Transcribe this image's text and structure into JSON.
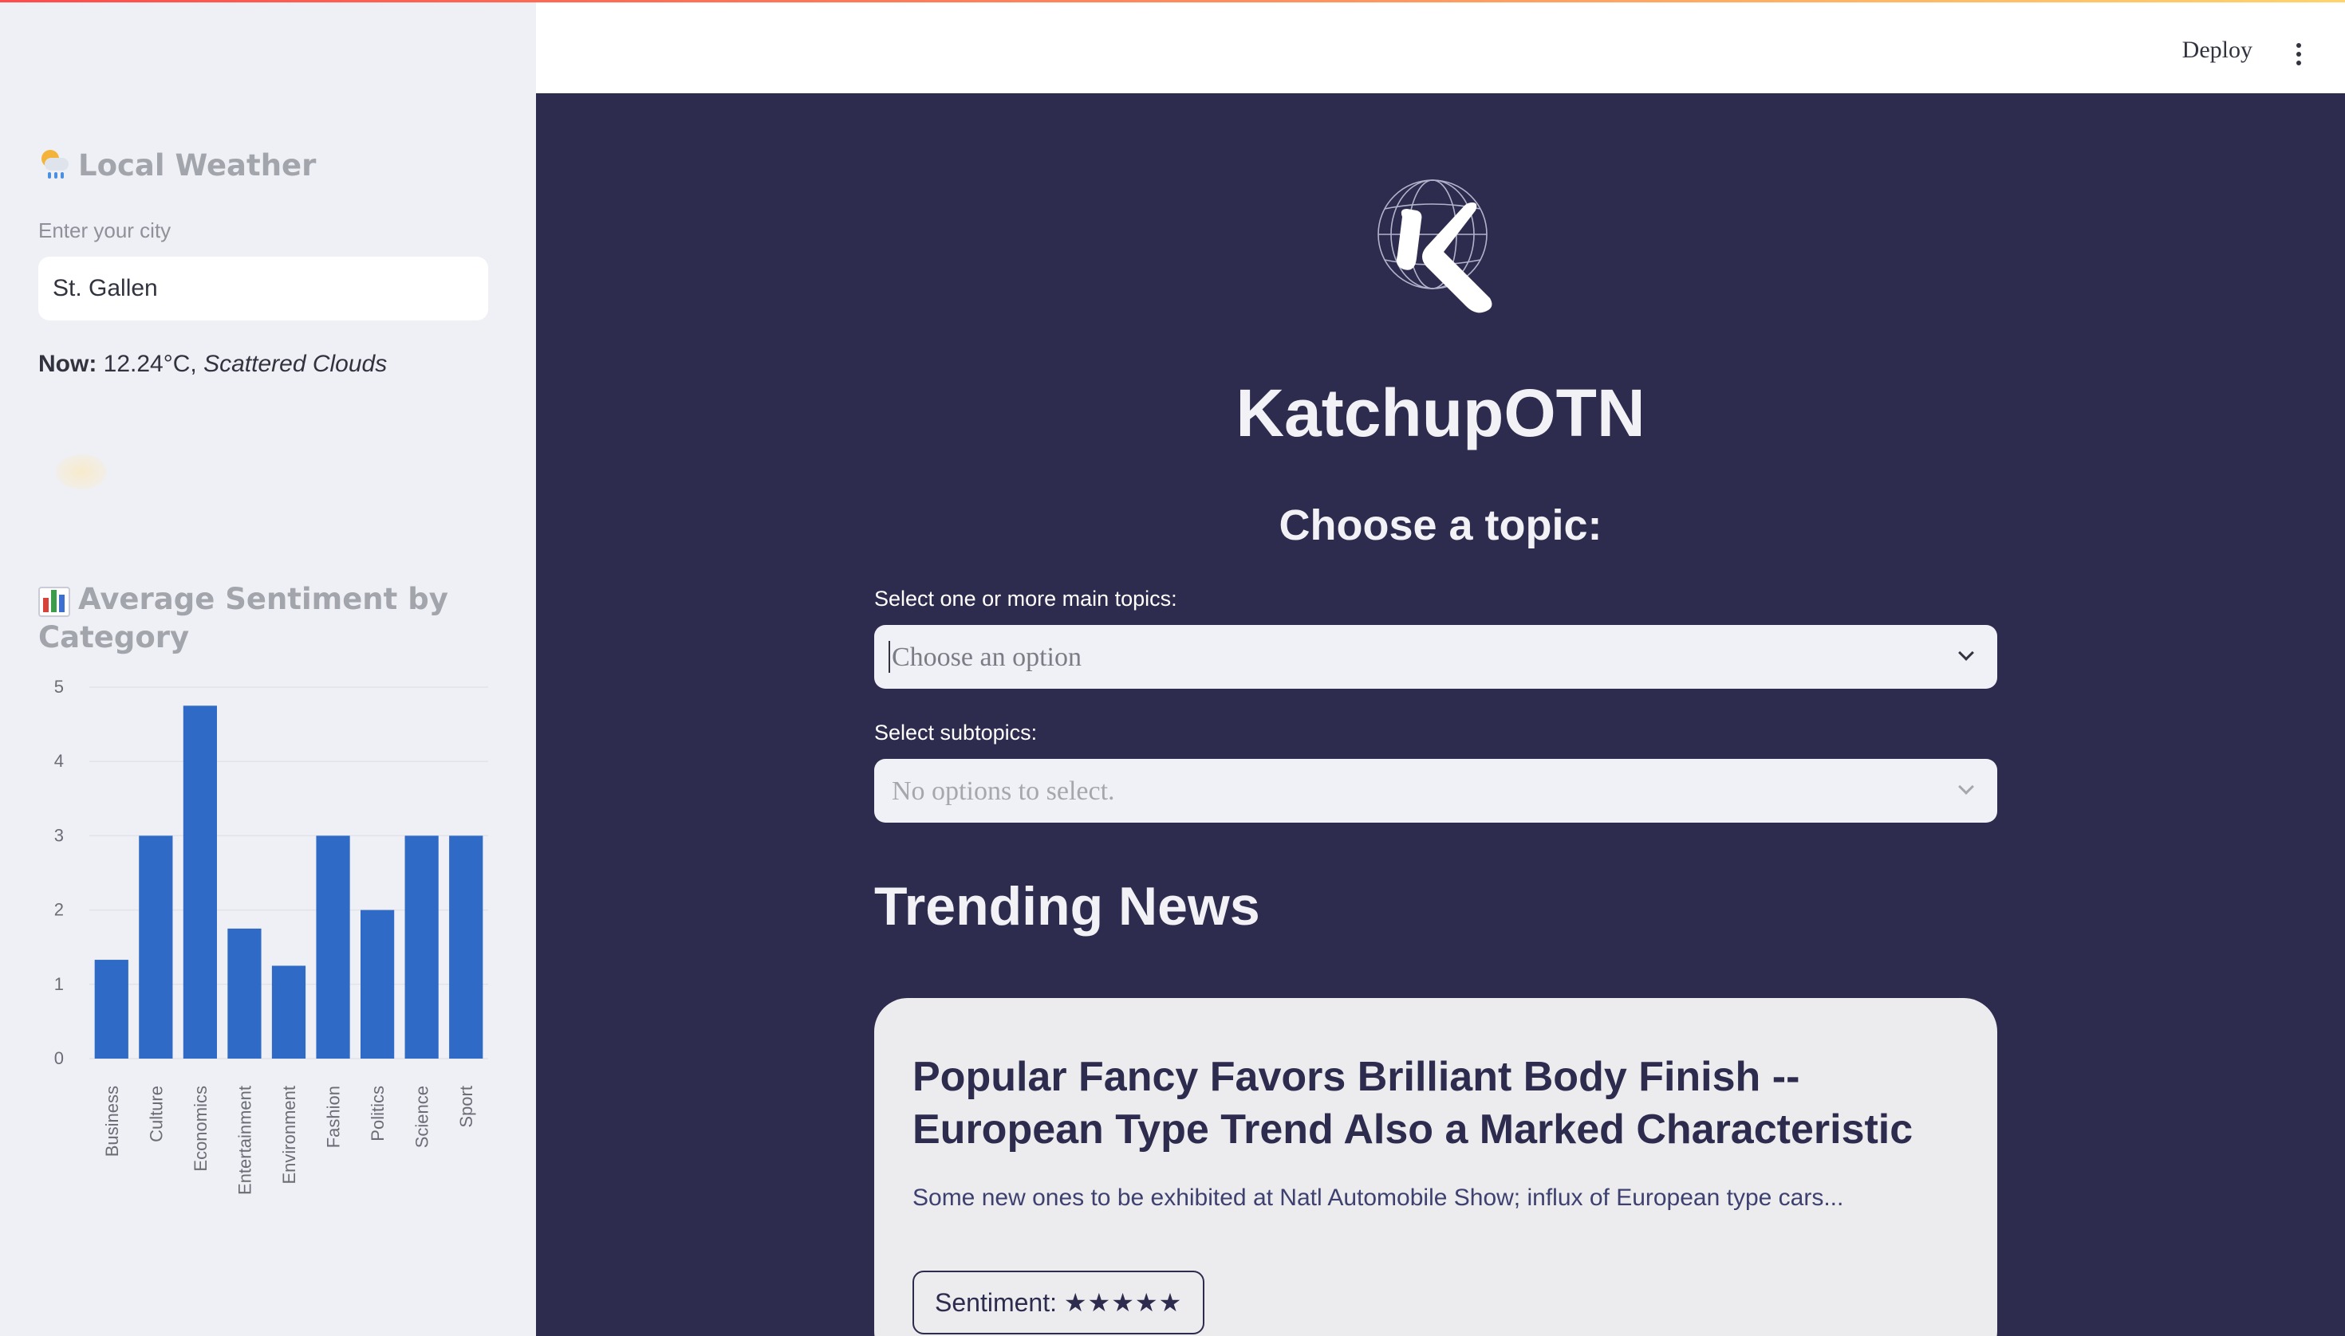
{
  "header": {
    "deploy_label": "Deploy"
  },
  "sidebar": {
    "weather": {
      "icon": "sun-cloud-rain-icon",
      "title": "Local Weather",
      "city_label": "Enter your city",
      "city_value": "St. Gallen",
      "now_label": "Now:",
      "now_temp": "12.24°C,",
      "now_condition": "Scattered Clouds"
    },
    "sentiment": {
      "icon": "bar-chart-icon",
      "title_line1": "Average Sentiment by",
      "title_line2": "Category"
    }
  },
  "main": {
    "app_title": "KatchupOTN",
    "choose_heading": "Choose a topic:",
    "main_topics_label": "Select one or more main topics:",
    "main_topics_placeholder": "Choose an option",
    "subtopics_label": "Select subtopics:",
    "subtopics_placeholder": "No options to select.",
    "trending_heading": "Trending News",
    "news": [
      {
        "title": "Popular Fancy Favors Brilliant Body Finish -- European Type Trend Also a Marked Characteristic",
        "description": "Some new ones to be exhibited at Natl Automobile Show; influx of European type cars...",
        "sentiment_label": "Sentiment:",
        "sentiment_stars": "★★★★★"
      }
    ]
  },
  "colors": {
    "main_bg": "#2d2b4e",
    "sidebar_bg": "#eff0f5",
    "bar": "#2f6bc6",
    "card_bg": "#ececee"
  },
  "chart_data": {
    "type": "bar",
    "title": "",
    "xlabel": "",
    "ylabel": "",
    "categories": [
      "Business",
      "Culture",
      "Economics",
      "Entertainment",
      "Environment",
      "Fashion",
      "Politics",
      "Science",
      "Sport"
    ],
    "values": [
      1.33,
      3.0,
      4.75,
      1.75,
      1.25,
      3.0,
      2.0,
      3.0,
      3.0
    ],
    "yticks": [
      0,
      1,
      2,
      3,
      4,
      5
    ],
    "ylim": [
      0,
      5
    ],
    "grid": true,
    "color": "#2f6bc6"
  }
}
